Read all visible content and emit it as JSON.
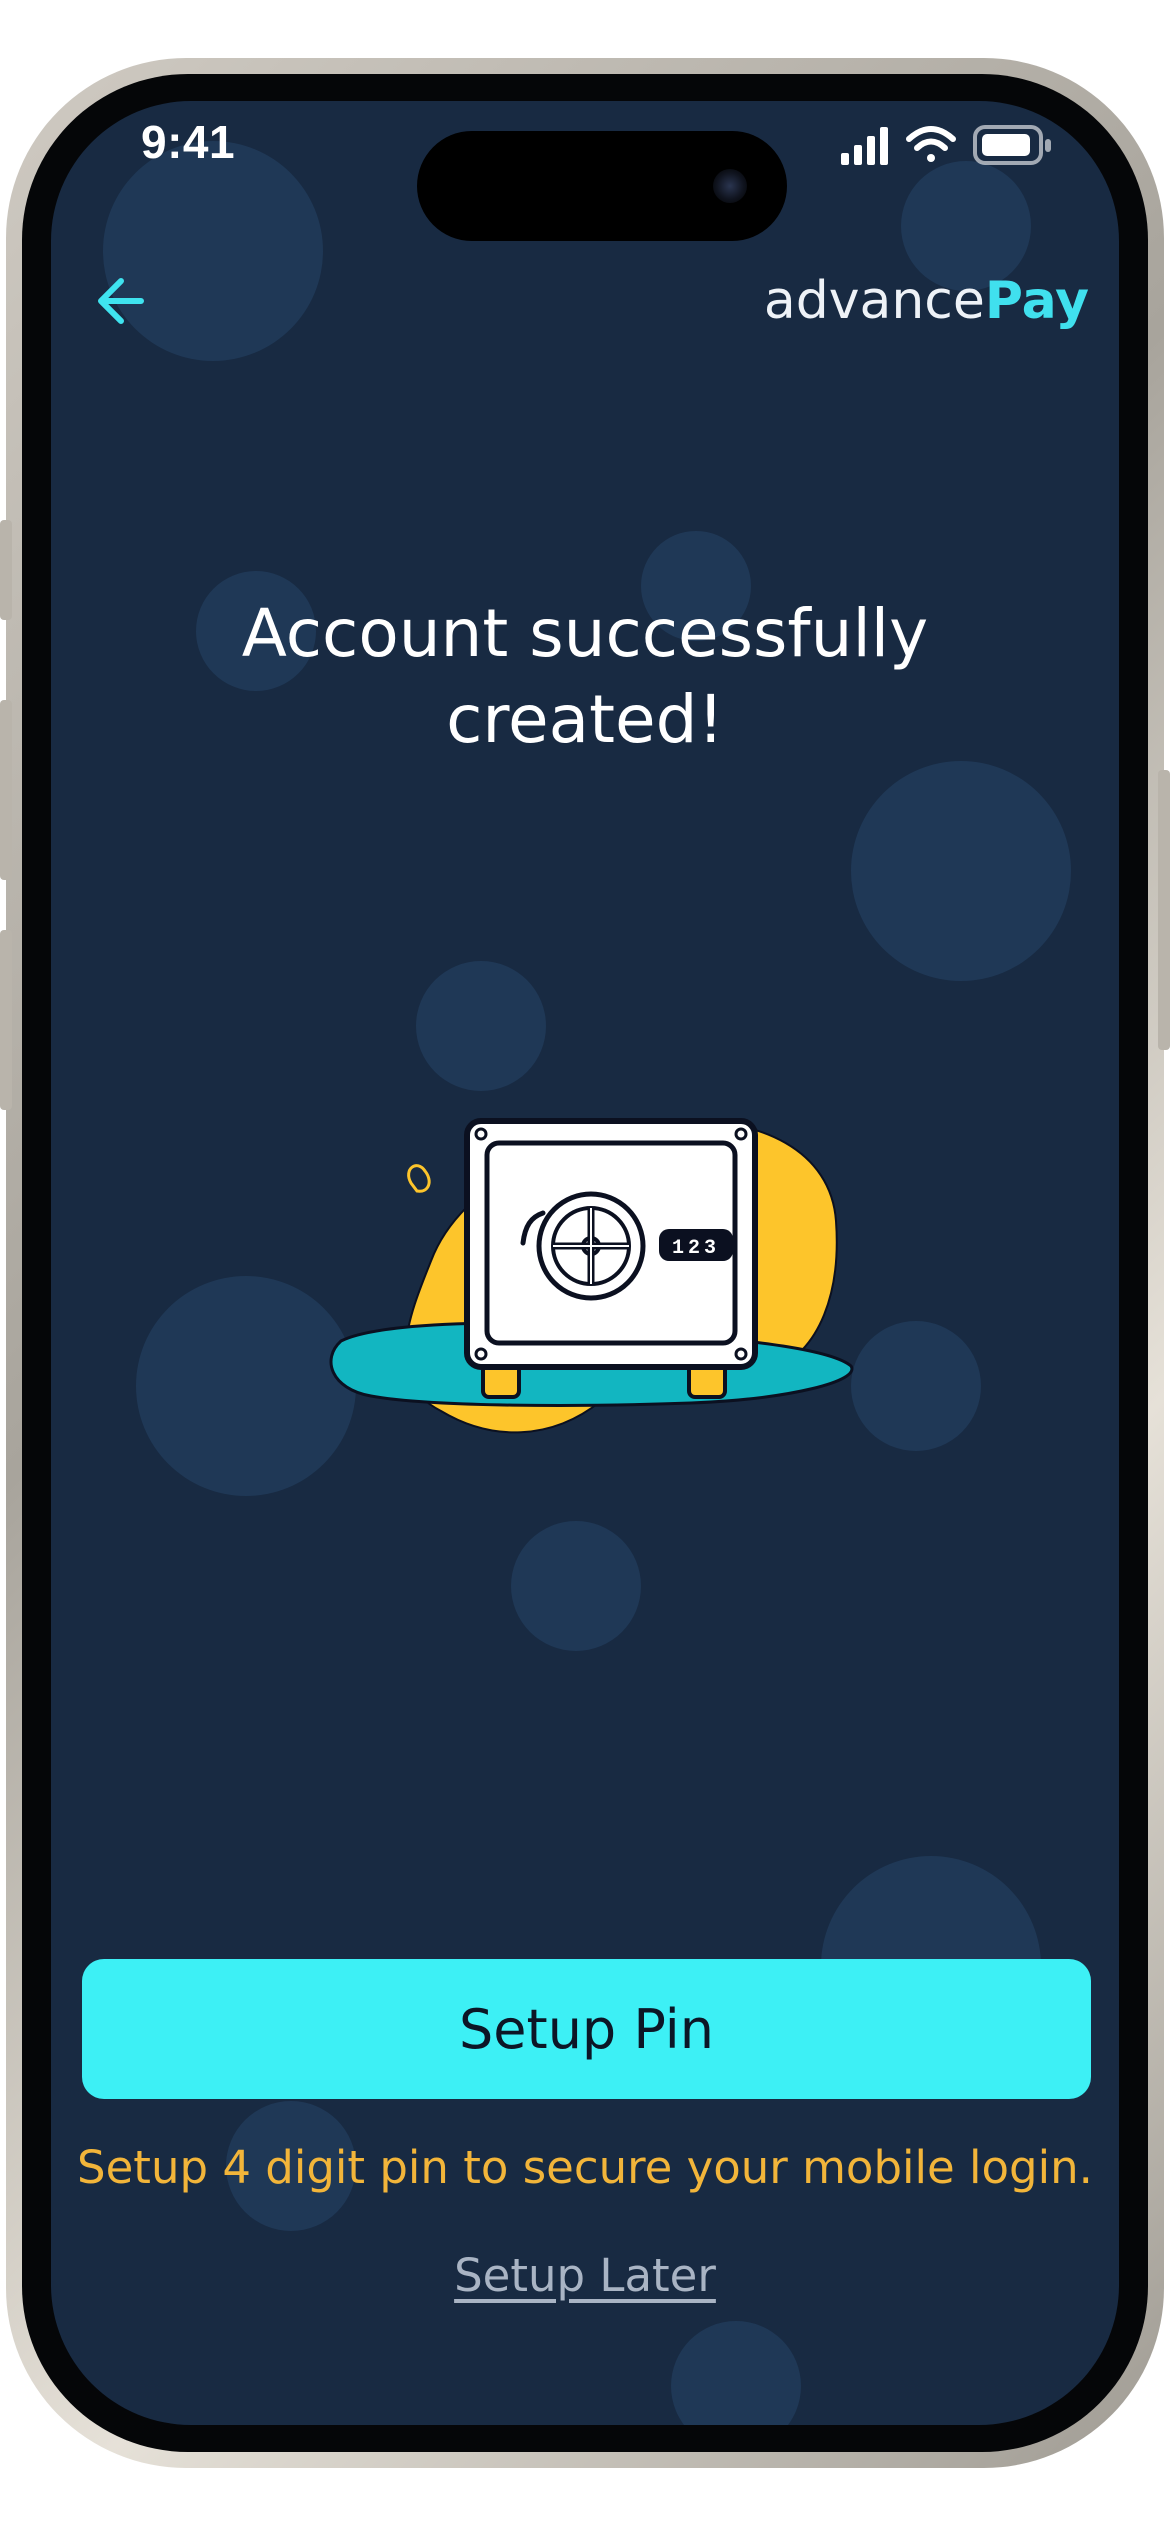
{
  "status_bar": {
    "time": "9:41",
    "icons": [
      "signal-bars-icon",
      "wifi-icon",
      "battery-icon"
    ]
  },
  "header": {
    "back_icon": "arrow-left-icon",
    "brand_prefix": "advance",
    "brand_suffix": "Pay"
  },
  "main": {
    "title_line1": "Account successfully",
    "title_line2": "created!",
    "illustration": "safe-illustration",
    "safe_code": "123"
  },
  "actions": {
    "primary_label": "Setup Pin",
    "hint": "Setup 4 digit pin to secure your mobile login.",
    "secondary_label": "Setup Later"
  },
  "colors": {
    "background": "#182a42",
    "accent": "#3df0f5",
    "hint": "#f2b53a",
    "blob_yellow": "#fdc52b",
    "blob_teal": "#12b6c1"
  }
}
